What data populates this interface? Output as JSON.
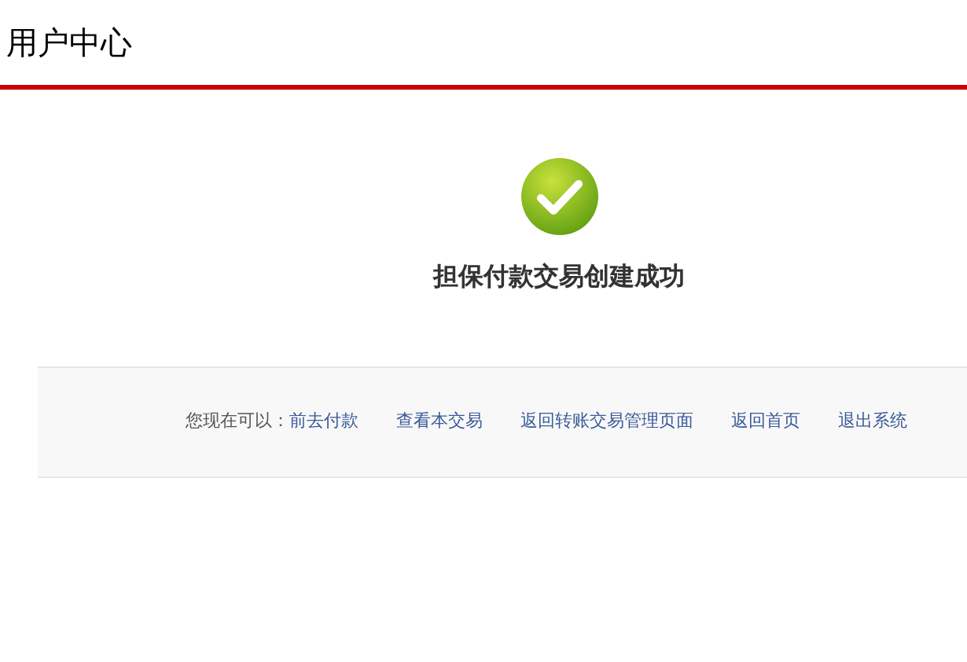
{
  "header": {
    "title": "用户中心"
  },
  "result": {
    "success": true,
    "message": "担保付款交易创建成功"
  },
  "actions": {
    "prompt": "您现在可以：",
    "links": [
      "前去付款",
      "查看本交易",
      "返回转账交易管理页面",
      "返回首页",
      "退出系统"
    ]
  }
}
